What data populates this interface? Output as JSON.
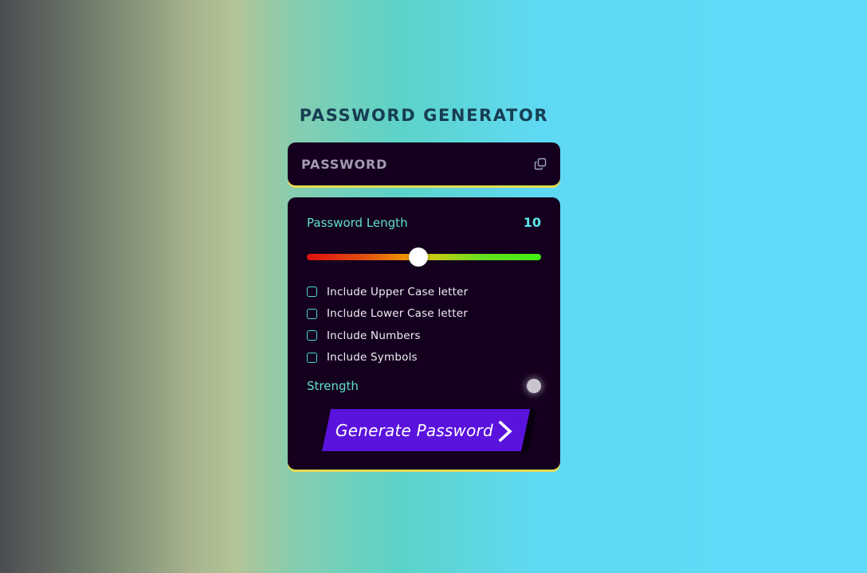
{
  "header": {
    "title": "PASSWORD GENERATOR"
  },
  "display": {
    "text": "PASSWORD",
    "copy_icon": "copy-icon"
  },
  "length": {
    "label": "Password Length",
    "value": "10",
    "slider_fraction": 0.475
  },
  "options": [
    {
      "label": "Include Upper Case letter",
      "checked": false
    },
    {
      "label": "Include Lower Case letter",
      "checked": false
    },
    {
      "label": "Include Numbers",
      "checked": false
    },
    {
      "label": "Include Symbols",
      "checked": false
    }
  ],
  "strength": {
    "label": "Strength",
    "indicator_color": "#c9c5cf"
  },
  "generate": {
    "label": "Generate Password",
    "icon": "chevron-right-icon"
  },
  "colors": {
    "panel": "#14001e",
    "accent_yellow": "#e7dc52",
    "accent_teal": "#62e0c9",
    "button": "#5a12dd"
  }
}
